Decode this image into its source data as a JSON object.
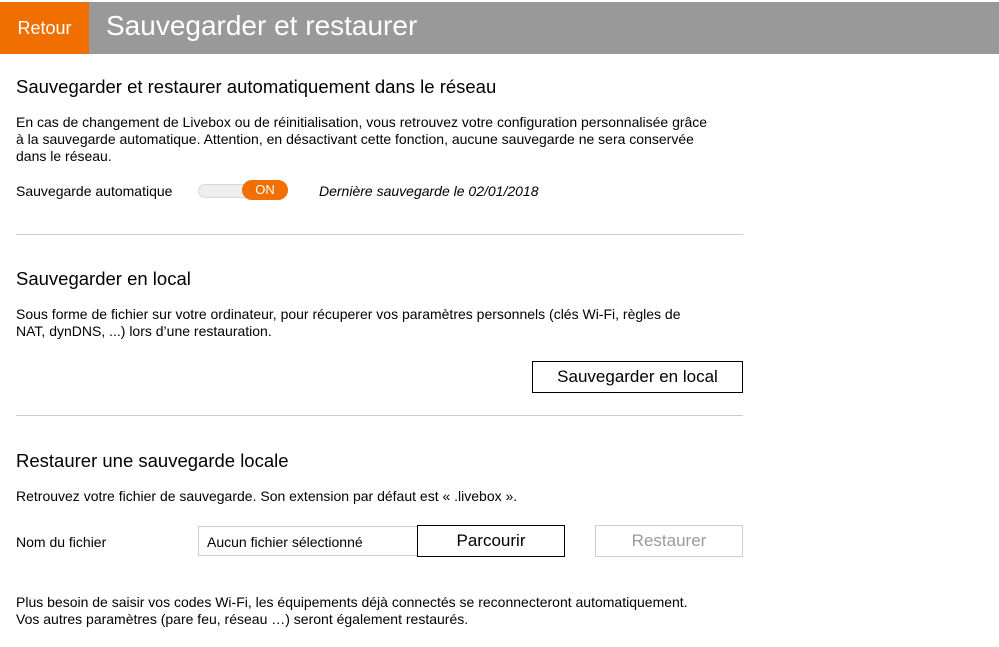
{
  "header": {
    "back_label": "Retour",
    "title": "Sauvegarder et restaurer"
  },
  "auto_section": {
    "title": "Sauvegarder et restaurer automatiquement dans le réseau",
    "text_lines": [
      "En cas de changement de Livebox ou de réinitialisation, vous retrouvez votre configuration personnalisée grâce",
      "à la sauvegarde automatique. Attention, en désactivant cette fonction, aucune sauvegarde ne sera conservée",
      "dans le réseau."
    ],
    "toggle_label": "Sauvegarde automatique",
    "toggle_state": "ON",
    "last_save": "Dernière sauvegarde le 02/01/2018"
  },
  "local_section": {
    "title": "Sauvegarder en local",
    "text_lines": [
      "Sous forme de fichier sur votre ordinateur, pour récuperer vos paramètres personnels (clés Wi-Fi, règles de",
      "NAT, dynDNS, ...) lors d’une restauration."
    ],
    "button_label": "Sauvegarder en local"
  },
  "restore_section": {
    "title": "Restaurer une sauvegarde locale",
    "text": "Retrouvez votre fichier de sauvegarde. Son extension par défaut est « .livebox ».",
    "file_label": "Nom du fichier",
    "file_value": "Aucun fichier sélectionné",
    "browse_label": "Parcourir",
    "restore_label": "Restaurer",
    "note_lines": [
      "Plus besoin de saisir vos codes Wi-Fi, les équipements déjà connectés se reconnecteront automatiquement.",
      "Vos autres paramètres (pare feu, réseau …) seront également restaurés."
    ]
  },
  "colors": {
    "accent": "#f16e00",
    "header_bg": "#999999",
    "divider": "#cccccc"
  }
}
